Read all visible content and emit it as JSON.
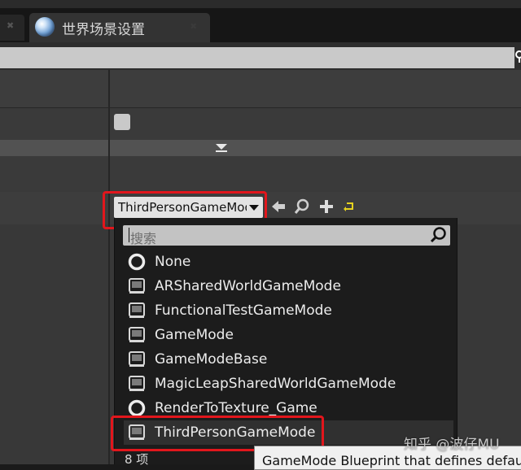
{
  "tab": {
    "title": "世界场景设置",
    "close_glyph": "✖",
    "prev_close_glyph": "✖"
  },
  "combo": {
    "selected_label": "ThirdPersonGameMode"
  },
  "dropdown": {
    "search_placeholder": "搜索",
    "items": [
      {
        "label": "None",
        "icon": "none-circle-icon"
      },
      {
        "label": "ARSharedWorldGameMode",
        "icon": "blueprint-class-icon"
      },
      {
        "label": "FunctionalTestGameMode",
        "icon": "blueprint-class-icon"
      },
      {
        "label": "GameMode",
        "icon": "blueprint-class-icon"
      },
      {
        "label": "GameModeBase",
        "icon": "blueprint-class-icon"
      },
      {
        "label": "MagicLeapSharedWorldGameMode",
        "icon": "blueprint-class-icon"
      },
      {
        "label": "RenderToTexture_Game",
        "icon": "none-circle-icon"
      },
      {
        "label": "ThirdPersonGameMode",
        "icon": "blueprint-class-icon",
        "selected": true
      }
    ],
    "count_label": "8 项"
  },
  "tooltip": {
    "text": "GameMode Blueprint that defines default"
  },
  "watermark": "知乎 @波仔MU",
  "colors": {
    "highlight_red": "#e2161c",
    "panel_bg": "#3c3c3c",
    "dropdown_bg": "#1c1c1c",
    "undo_yellow": "#e6d21f"
  }
}
